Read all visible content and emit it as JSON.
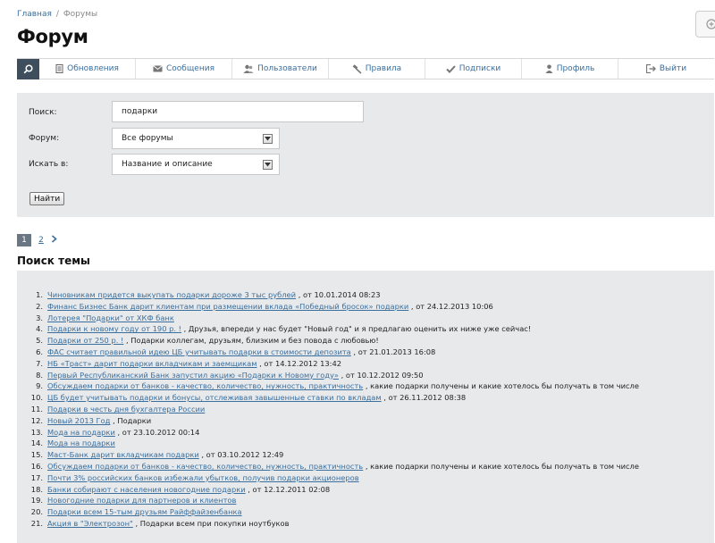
{
  "breadcrumb": {
    "home": "Главная",
    "separator": "/",
    "current": "Форумы"
  },
  "page_title": "Форум",
  "nav": {
    "items": [
      {
        "label": "Обновления",
        "icon": "document-icon"
      },
      {
        "label": "Сообщения",
        "icon": "envelope-icon"
      },
      {
        "label": "Пользователи",
        "icon": "users-icon"
      },
      {
        "label": "Правила",
        "icon": "gavel-icon"
      },
      {
        "label": "Подписки",
        "icon": "checkmark-icon"
      },
      {
        "label": "Профиль",
        "icon": "user-icon"
      },
      {
        "label": "Выйти",
        "icon": "logout-icon"
      }
    ]
  },
  "search_form": {
    "query_label": "Поиск:",
    "query_value": "подарки",
    "forum_label": "Форум:",
    "forum_value": "Все форумы",
    "scope_label": "Искать в:",
    "scope_value": "Название и описание",
    "submit_label": "Найти"
  },
  "pagination": {
    "current": "1",
    "next": "2"
  },
  "results": {
    "heading": "Поиск темы",
    "items": [
      {
        "num": "1.",
        "title": "Чиновникам придется выкупать подарки дороже 3 тыс рублей",
        "suffix": " , от 10.01.2014 08:23"
      },
      {
        "num": "2.",
        "title": "Финанс Бизнес Банк дарит клиентам при размещении вклада «Победный бросок» подарки",
        "suffix": " , от 24.12.2013 10:06"
      },
      {
        "num": "3.",
        "title": "Лотерея \"Подарки\" от ХКФ банк",
        "suffix": ""
      },
      {
        "num": "4.",
        "title": "Подарки к новому году от 190 р. !",
        "suffix": " , Друзья, впереди у нас будет \"Новый год\" и я предлагаю оценить их ниже уже сейчас!"
      },
      {
        "num": "5.",
        "title": "Подарки от 250 р. !",
        "suffix": " , Подарки коллегам, друзьям, близким и без повода с любовью!"
      },
      {
        "num": "6.",
        "title": "ФАС считает правильной идею ЦБ учитывать подарки в стоимости депозита",
        "suffix": " , от 21.01.2013 16:08"
      },
      {
        "num": "7.",
        "title": "НБ «Траст» дарит подарки вкладчикам и заемщикам",
        "suffix": " , от 14.12.2012 13:42"
      },
      {
        "num": "8.",
        "title": "Первый Республиканский Банк запустил акцию «Подарки к Новому году»",
        "suffix": " , от 10.12.2012 09:50"
      },
      {
        "num": "9.",
        "title": "Обсуждаем подарки от банков - качество, количество, нужность, практичность",
        "suffix": " , какие подарки получены и какие хотелось бы получать в том числе"
      },
      {
        "num": "10.",
        "title": "ЦБ будет учитывать подарки и бонусы, отслеживая завышенные ставки по вкладам",
        "suffix": " , от 26.11.2012 08:38"
      },
      {
        "num": "11.",
        "title": "Подарки в честь дня бухгалтера России",
        "suffix": ""
      },
      {
        "num": "12.",
        "title": "Новый 2013 Год",
        "suffix": " , Подарки"
      },
      {
        "num": "13.",
        "title": "Мода на подарки",
        "suffix": " , от 23.10.2012 00:14"
      },
      {
        "num": "14.",
        "title": "Мода на подарки",
        "suffix": ""
      },
      {
        "num": "15.",
        "title": "Маст-Банк дарит вкладчикам подарки",
        "suffix": " , от 03.10.2012 12:49"
      },
      {
        "num": "16.",
        "title": "Обсуждаем подарки от банков - качество, количество, нужность, практичность",
        "suffix": " , какие подарки получены и какие хотелось бы получать в том числе"
      },
      {
        "num": "17.",
        "title": "Почти 3% российских банков избежали убытков, получив подарки акционеров",
        "suffix": ""
      },
      {
        "num": "18.",
        "title": "Банки собирают с населения новогодние подарки",
        "suffix": " , от 12.12.2011 02:08"
      },
      {
        "num": "19.",
        "title": "Новогодние подарки для партнеров и клиентов",
        "suffix": ""
      },
      {
        "num": "20.",
        "title": "Подарки всем 15-тым друзьям Райффайзенбанка",
        "suffix": ""
      },
      {
        "num": "21.",
        "title": "Акция в \"Электрозон\"",
        "suffix": " , Подарки всем при покупки ноутбуков"
      }
    ]
  },
  "colors": {
    "link": "#3a6f9e",
    "panel": "#e7e9eb",
    "search_button_bg": "#3e4e5c",
    "pager_current_bg": "#6a7783"
  }
}
